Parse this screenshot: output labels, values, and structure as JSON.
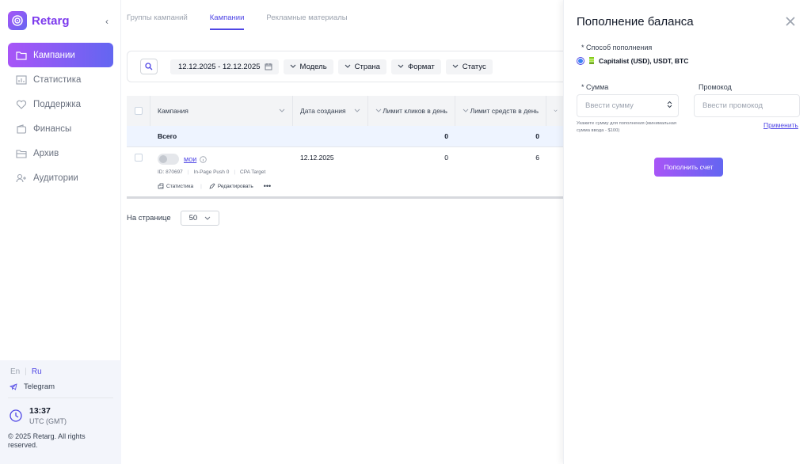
{
  "sidebar": {
    "brand": "Retarg",
    "items": [
      {
        "label": "Кампании"
      },
      {
        "label": "Статистика"
      },
      {
        "label": "Поддержка"
      },
      {
        "label": "Финансы"
      },
      {
        "label": "Архив"
      },
      {
        "label": "Аудитории"
      }
    ],
    "lang_en": "En",
    "lang_ru": "Ru",
    "telegram": "Telegram",
    "time": "13:37",
    "timezone": "UTC (GMT)",
    "copyright": "© 2025 Retarg. All rights reserved."
  },
  "tabs": [
    {
      "label": "Группы кампаний"
    },
    {
      "label": "Кампании"
    },
    {
      "label": "Рекламные материалы"
    }
  ],
  "filters": {
    "date_range": "12.12.2025 - 12.12.2025",
    "model": "Модель",
    "country": "Страна",
    "format": "Формат",
    "status": "Статус"
  },
  "table": {
    "headers": {
      "campaign": "Кампания",
      "created": "Дата создания",
      "click_limit": "Лимит кликов в день",
      "spend_limit": "Лимит средств в день"
    },
    "total": {
      "label": "Всего",
      "clicks": "0",
      "spend": "0"
    },
    "rows": [
      {
        "name": "мои",
        "id": "ID: 870697",
        "format": "In-Page Push 0",
        "model": "CPA Target",
        "created": "12.12.2025",
        "clicks": "0",
        "spend": "6",
        "stats_label": "Статистика",
        "edit_label": "Редактировать",
        "more": "•••"
      }
    ]
  },
  "pagination": {
    "label": "На странице",
    "value": "50"
  },
  "drawer": {
    "title": "Пополнение баланса",
    "method_label": "* Способ пополнения",
    "method_option": "Capitalist (USD), USDT, BTC",
    "amount_label": "* Сумма",
    "amount_placeholder": "Ввести сумму",
    "promo_label": "Промокод",
    "promo_placeholder": "Ввести промокод",
    "hint": "Укажите сумму для пополнения (минимальная сумма ввода - $100)",
    "apply": "Применить",
    "submit": "Пополнить счет"
  },
  "colors": {
    "accent": "#4f46e5",
    "gradient_start": "#a855f7",
    "gradient_end": "#6366f1"
  }
}
